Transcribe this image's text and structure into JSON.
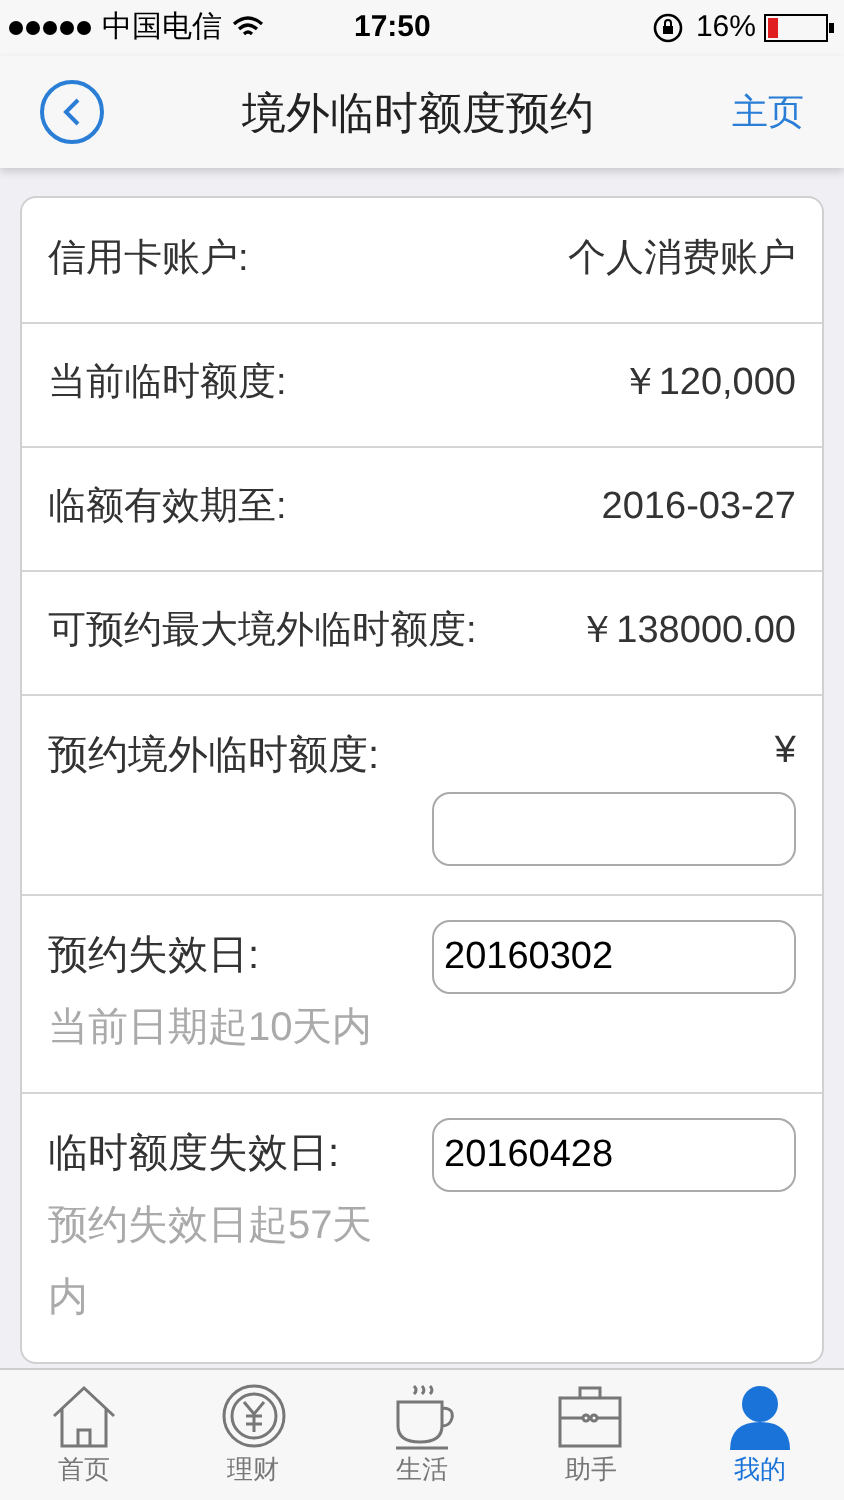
{
  "status_bar": {
    "carrier": "中国电信",
    "time": "17:50",
    "battery": "16%"
  },
  "nav": {
    "title": "境外临时额度预约",
    "home_link": "主页"
  },
  "rows": [
    {
      "kind": "info",
      "label": "信用卡账户:",
      "value": "个人消费账户"
    },
    {
      "kind": "info",
      "label": "当前临时额度:",
      "value": "￥120,000"
    },
    {
      "kind": "info",
      "label": "临额有效期至:",
      "value": "2016-03-27"
    },
    {
      "kind": "info",
      "label": "可预约最大境外临时额度:",
      "value": "￥138000.00"
    },
    {
      "kind": "input",
      "label": "预约境外临时额度:",
      "currency": "¥"
    },
    {
      "kind": "input",
      "label": "预约失效日:",
      "value": "20160302",
      "note": "当前日期起10天内"
    },
    {
      "kind": "input",
      "label": "临时额度失效日:",
      "value": "20160428",
      "note": "预约失效日起57天内"
    }
  ],
  "tab_bar": [
    {
      "label": "首页",
      "selected": false
    },
    {
      "label": "理财",
      "selected": false
    },
    {
      "label": "生活",
      "selected": false
    },
    {
      "label": "助手",
      "selected": false
    },
    {
      "label": "我的",
      "selected": true
    }
  ]
}
